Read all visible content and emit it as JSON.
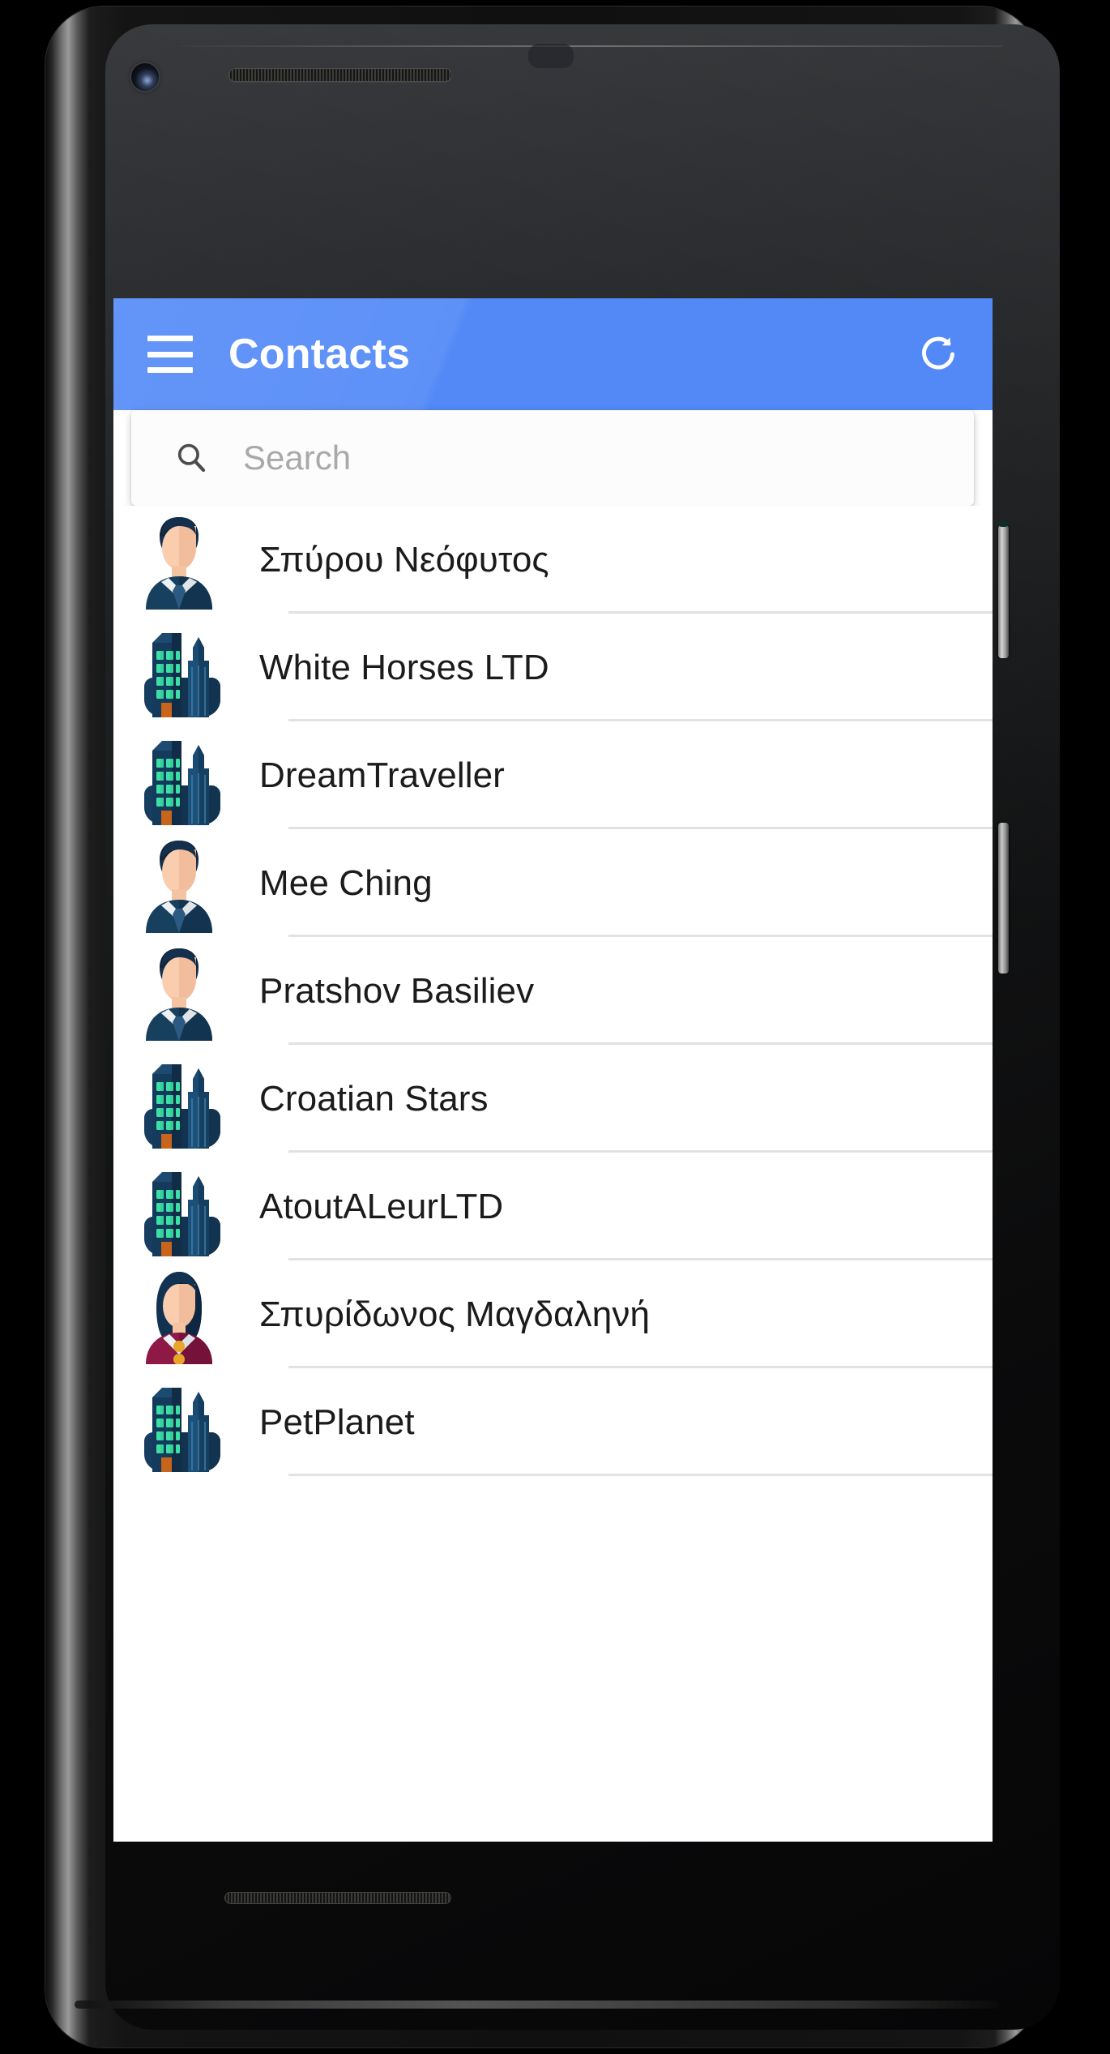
{
  "device": {
    "name": "android-smartphone",
    "camera": "front-camera",
    "earpiece": "earpiece-speaker",
    "sensor": "proximity-sensor",
    "power_button": "power-button",
    "volume_button": "volume-button",
    "bottom_speaker": "bottom-speaker"
  },
  "appbar": {
    "title": "Contacts",
    "menu_icon": "hamburger-menu-icon",
    "refresh_icon": "refresh-icon",
    "background_color": "#5289f7",
    "text_color": "#ffffff"
  },
  "search": {
    "placeholder": "Search",
    "value": "",
    "icon": "search-icon"
  },
  "list": {
    "divider_color": "#e2e2e2",
    "items": [
      {
        "name": "Σπύρου Νεόφυτος",
        "avatar": "person-male-avatar"
      },
      {
        "name": "White Horses LTD",
        "avatar": "company-building-avatar"
      },
      {
        "name": "DreamTraveller",
        "avatar": "company-building-avatar"
      },
      {
        "name": "Mee Ching",
        "avatar": "person-male-avatar"
      },
      {
        "name": "Pratshov Basiliev",
        "avatar": "person-male-avatar"
      },
      {
        "name": "Croatian Stars",
        "avatar": "company-building-avatar"
      },
      {
        "name": "AtoutALeurLTD",
        "avatar": "company-building-avatar"
      },
      {
        "name": "Σπυρίδωνος Μαγδαληνή",
        "avatar": "person-female-avatar"
      },
      {
        "name": "PetPlanet",
        "avatar": "company-building-avatar"
      }
    ]
  },
  "colors": {
    "accent": "#5289f7",
    "avatar_suit": "#16385c",
    "avatar_skin": "#f7c9ab",
    "avatar_hair": "#122b45",
    "building_dark": "#123152",
    "building_window": "#3ce0a6",
    "building_door": "#c8651c",
    "female_jacket": "#8e1945"
  }
}
